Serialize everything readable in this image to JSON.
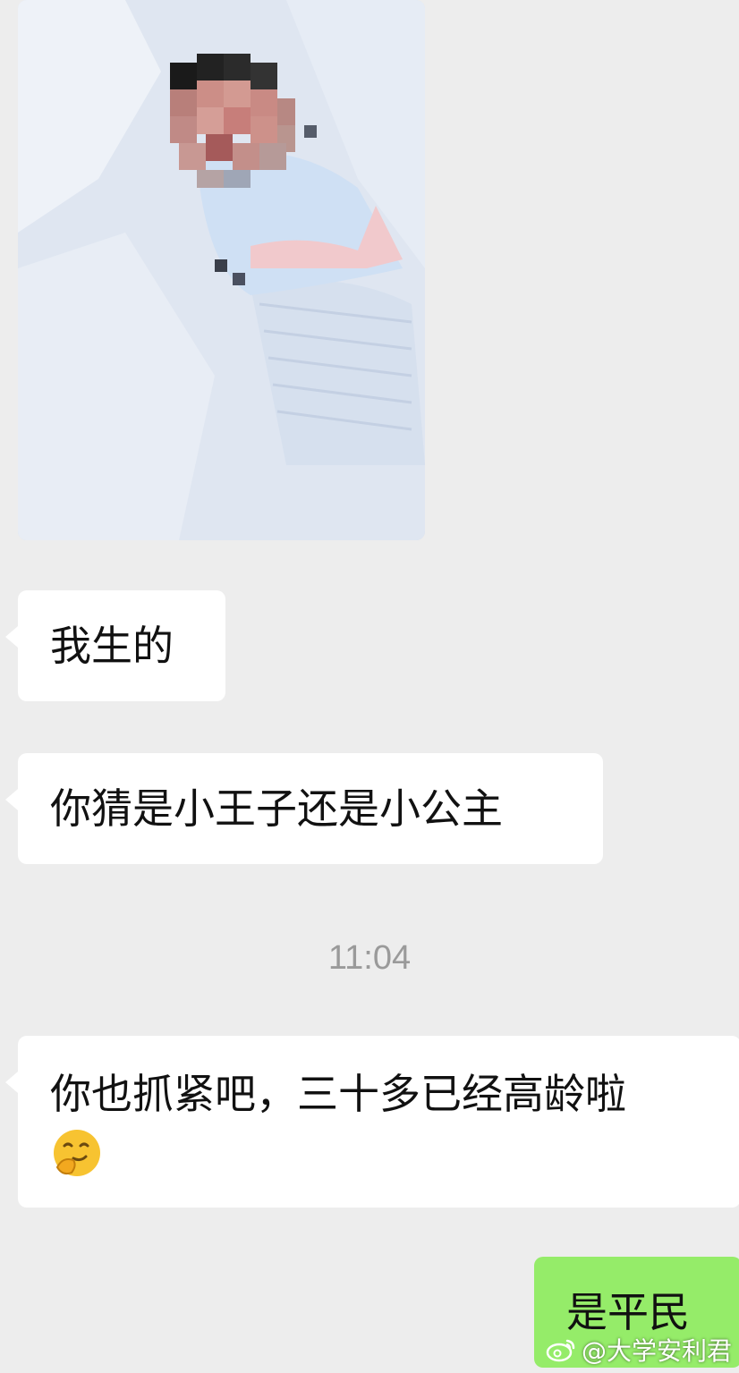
{
  "messages": {
    "m1": "我生的",
    "m2": "你猜是小王子还是小公主",
    "timestamp": "11:04",
    "m3": "你也抓紧吧，三十多已经高龄啦",
    "m3_emoji": "covering-mouth-smile-emoji",
    "m4": "是平民"
  },
  "photo": {
    "subject": "baby-photo-pixelated"
  },
  "watermark": {
    "text": "@大学安利君",
    "icon": "weibo-icon"
  },
  "colors": {
    "background": "#ededed",
    "incoming_bubble": "#ffffff",
    "outgoing_bubble": "#95ec69",
    "timestamp": "#9a9a9a"
  }
}
